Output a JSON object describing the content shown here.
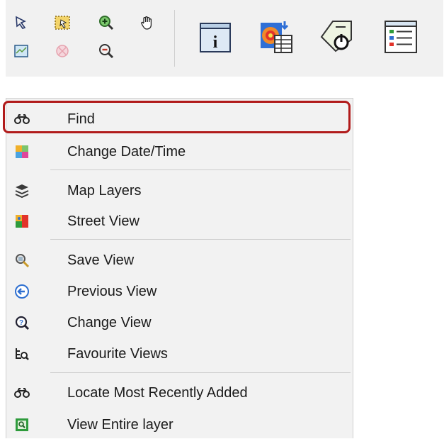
{
  "toolbar": {
    "small_buttons": [
      {
        "name": "select-arrow-icon"
      },
      {
        "name": "select-rectangle-icon"
      },
      {
        "name": "zoom-in-icon"
      },
      {
        "name": "pan-hand-icon"
      },
      {
        "name": "map-extent-icon"
      },
      {
        "name": "disabled-globe-icon"
      },
      {
        "name": "zoom-out-icon"
      }
    ],
    "large_buttons": [
      {
        "name": "identify-info-icon",
        "glyph": "i"
      },
      {
        "name": "layer-attributes-icon"
      },
      {
        "name": "tag-power-icon"
      },
      {
        "name": "legend-list-icon"
      }
    ]
  },
  "menu": {
    "items": [
      {
        "label": "Find",
        "icon": "binoculars-icon"
      },
      {
        "label": "Change Date/Time",
        "icon": "calendar-color-icon"
      },
      {
        "label": "Map Layers",
        "icon": "layers-stack-icon"
      },
      {
        "label": "Street View",
        "icon": "street-view-icon"
      },
      {
        "label": "Save View",
        "icon": "save-view-magnifier-icon"
      },
      {
        "label": "Previous View",
        "icon": "previous-arrow-circle-icon"
      },
      {
        "label": "Change View",
        "icon": "change-view-icon"
      },
      {
        "label": "Favourite Views",
        "icon": "favourite-views-icon"
      },
      {
        "label": "Locate Most Recently Added",
        "icon": "binoculars-icon"
      },
      {
        "label": "View Entire layer",
        "icon": "view-entire-layer-icon"
      }
    ]
  },
  "colors": {
    "highlight": "#b11b1b",
    "menu_bg": "#f2f2f2",
    "toolbar_bg": "#f1f1f1"
  }
}
